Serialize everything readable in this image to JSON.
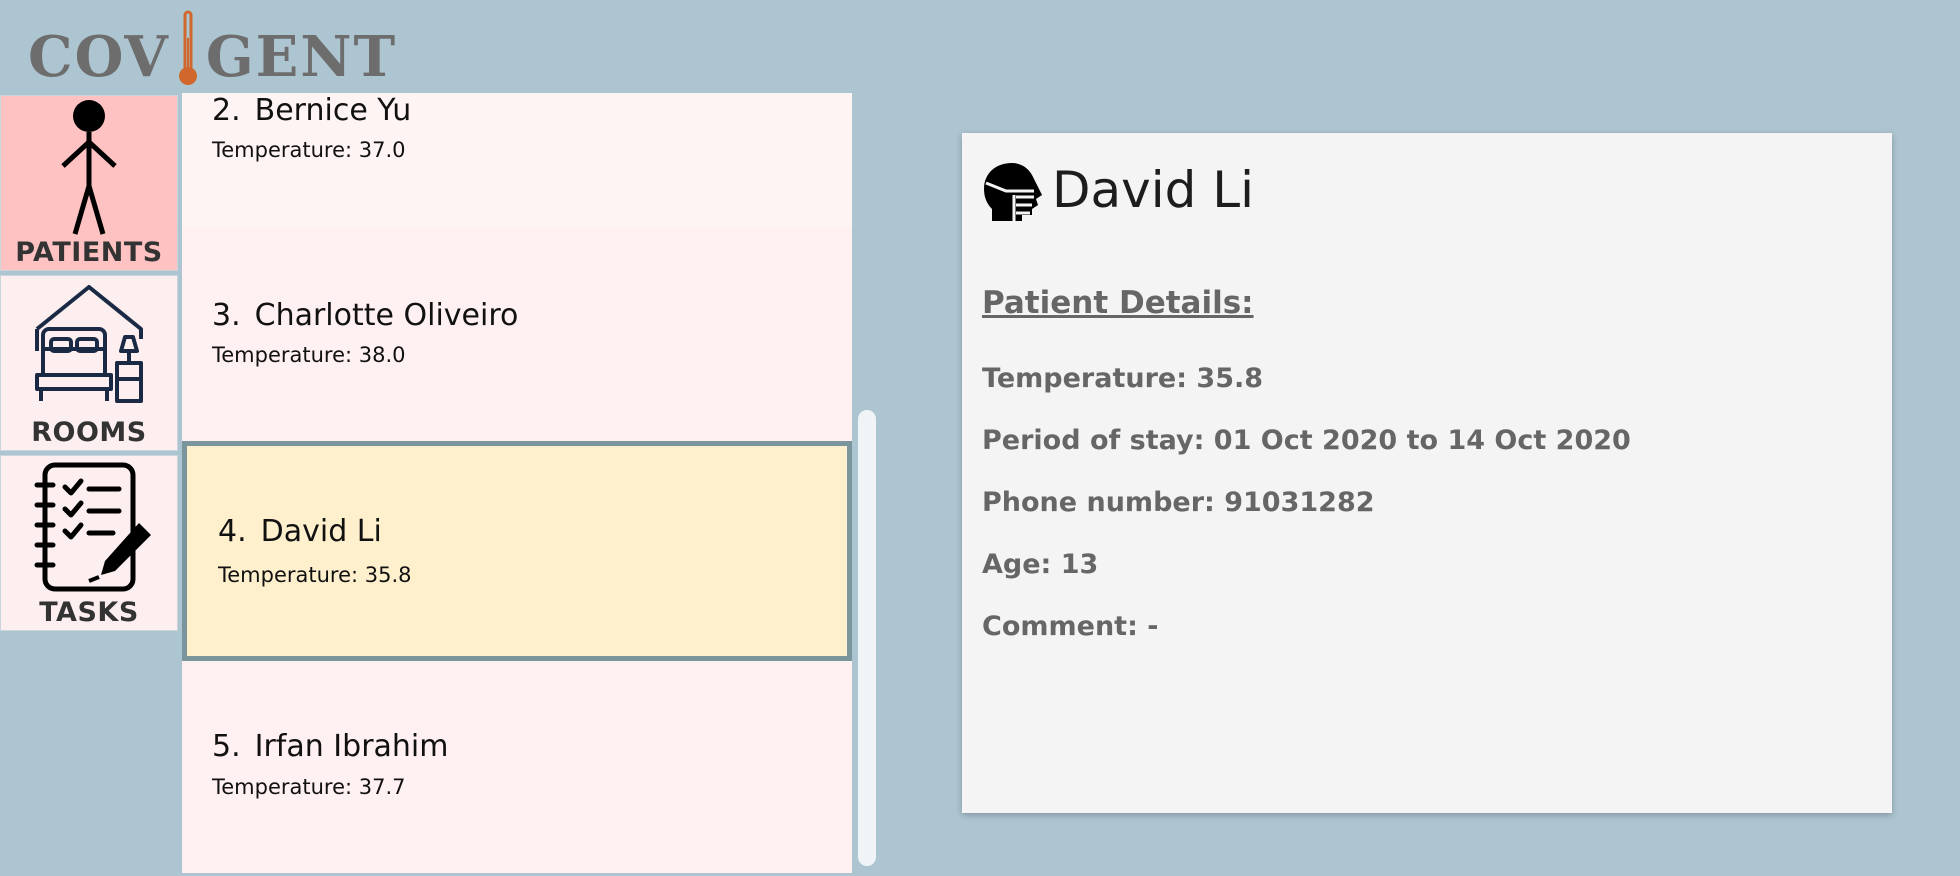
{
  "app": {
    "logo_left": "COV",
    "logo_right": "GENT"
  },
  "nav": [
    {
      "label": "PATIENTS",
      "icon": "stick-figure-icon",
      "active": true
    },
    {
      "label": "ROOMS",
      "icon": "bed-room-icon",
      "active": false
    },
    {
      "label": "TASKS",
      "icon": "checklist-notebook-icon",
      "active": false
    }
  ],
  "patients": [
    {
      "index": "2.",
      "name": "Bernice Yu",
      "temperature": "Temperature: 37.0"
    },
    {
      "index": "3.",
      "name": "Charlotte Oliveiro",
      "temperature": "Temperature: 38.0"
    },
    {
      "index": "4.",
      "name": "David Li",
      "temperature": "Temperature: 35.8",
      "selected": true
    },
    {
      "index": "5.",
      "name": "Irfan Ibrahim",
      "temperature": "Temperature: 37.7"
    }
  ],
  "detail": {
    "name": "David Li",
    "section_title": "Patient Details:",
    "fields": [
      "Temperature: 35.8",
      "Period of stay: 01 Oct 2020 to 14 Oct 2020",
      "Phone number: 91031282",
      "Age: 13",
      "Comment: -"
    ]
  },
  "colors": {
    "background": "#adc5d1",
    "nav_active": "#ffc2c2",
    "card": "#fff0f1",
    "card_selected": "#fff0cd",
    "card_selected_border": "#7a959c",
    "thermometer": "#d0672c"
  }
}
